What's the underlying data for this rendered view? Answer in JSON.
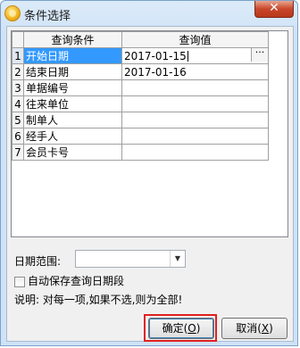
{
  "window": {
    "title": "条件选择",
    "close_glyph": "✕",
    "icon": "app-coin-icon"
  },
  "grid": {
    "headers": [
      "查询条件",
      "查询值"
    ],
    "rows": [
      {
        "index": "1",
        "condition": "开始日期",
        "value": "2017-01-15"
      },
      {
        "index": "2",
        "condition": "结束日期",
        "value": "2017-01-16"
      },
      {
        "index": "3",
        "condition": "单据编号",
        "value": ""
      },
      {
        "index": "4",
        "condition": "往来单位",
        "value": ""
      },
      {
        "index": "5",
        "condition": "制单人",
        "value": ""
      },
      {
        "index": "6",
        "condition": "经手人",
        "value": ""
      },
      {
        "index": "7",
        "condition": "会员卡号",
        "value": ""
      }
    ],
    "ellipsis": "···"
  },
  "date_range": {
    "label": "日期范围:",
    "value": "",
    "arrow": "▼"
  },
  "auto_save": {
    "label": "自动保存查询日期段",
    "checked": false
  },
  "hint": "说明: 对每一项,如果不选,则为全部!",
  "buttons": {
    "ok": {
      "label": "确定",
      "accel": "O"
    },
    "cancel": {
      "label": "取消",
      "accel": "X"
    }
  },
  "colors": {
    "selection": "#3399ff",
    "highlight": "#e02020"
  }
}
